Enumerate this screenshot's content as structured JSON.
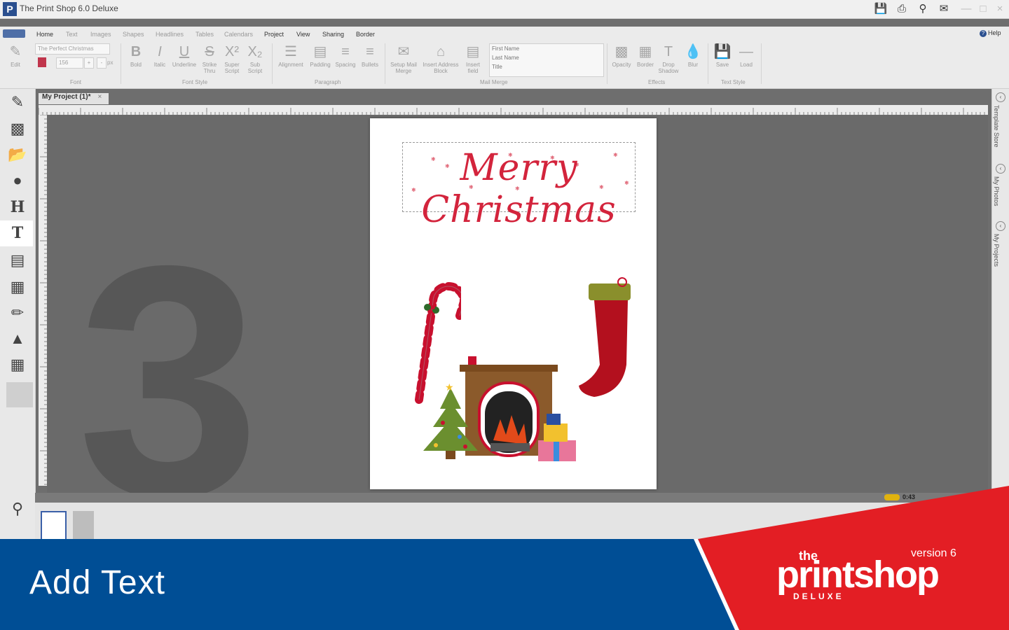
{
  "window": {
    "title": "The Print Shop 6.0 Deluxe",
    "logo_letter": "P"
  },
  "menu": {
    "tabs": [
      "Home",
      "Text",
      "Images",
      "Shapes",
      "Headlines",
      "Tables",
      "Calendars",
      "Project",
      "View",
      "Sharing",
      "Border"
    ],
    "help": "Help"
  },
  "ribbon": {
    "edit": "Edit",
    "font_name": "The Perfect Christmas",
    "font_size": "156",
    "font_unit": "px",
    "bold": "Bold",
    "italic": "Italic",
    "underline": "Underline",
    "strike": "Strike Thru",
    "superscript": "Super Script",
    "subscript": "Sub Script",
    "font_group": "Font",
    "font_style_group": "Font Style",
    "alignment": "Alignment",
    "padding": "Padding",
    "spacing": "Spacing",
    "bullets": "Bullets",
    "paragraph_group": "Paragraph",
    "setup_mail_merge": "Setup Mail Merge",
    "insert_address_block": "Insert Address Block",
    "insert_field": "Insert field",
    "merge_fields": [
      "First Name",
      "Last Name",
      "Title"
    ],
    "mail_merge_group": "Mail Merge",
    "opacity": "Opacity",
    "border": "Border",
    "drop_shadow": "Drop Shadow",
    "blur": "Blur",
    "effects_group": "Effects",
    "save": "Save",
    "load": "Load",
    "text_style_group": "Text Style"
  },
  "document": {
    "tab": "My Project (1)*",
    "close": "×"
  },
  "page": {
    "title_text": "Merry Christmas"
  },
  "overlay_step": "3",
  "side_panel": [
    "Template Store",
    "My Photos",
    "My Projects"
  ],
  "status": {
    "time": "0:43"
  },
  "banner": {
    "step_label": "Add Text",
    "logo_the": "the",
    "logo_main": "printshop",
    "logo_version": "version 6",
    "logo_deluxe": "DELUXE"
  },
  "colors": {
    "banner_blue": "#004e95",
    "banner_red": "#e31e24",
    "title_red": "#d3243c"
  },
  "icons": [
    "pencil-icon",
    "layout-icon",
    "open-folder-icon",
    "lightbulb-icon",
    "headline-icon",
    "text-icon",
    "image-icon",
    "photos-icon",
    "draw-icon",
    "shapes-icon",
    "calendar-icon"
  ]
}
